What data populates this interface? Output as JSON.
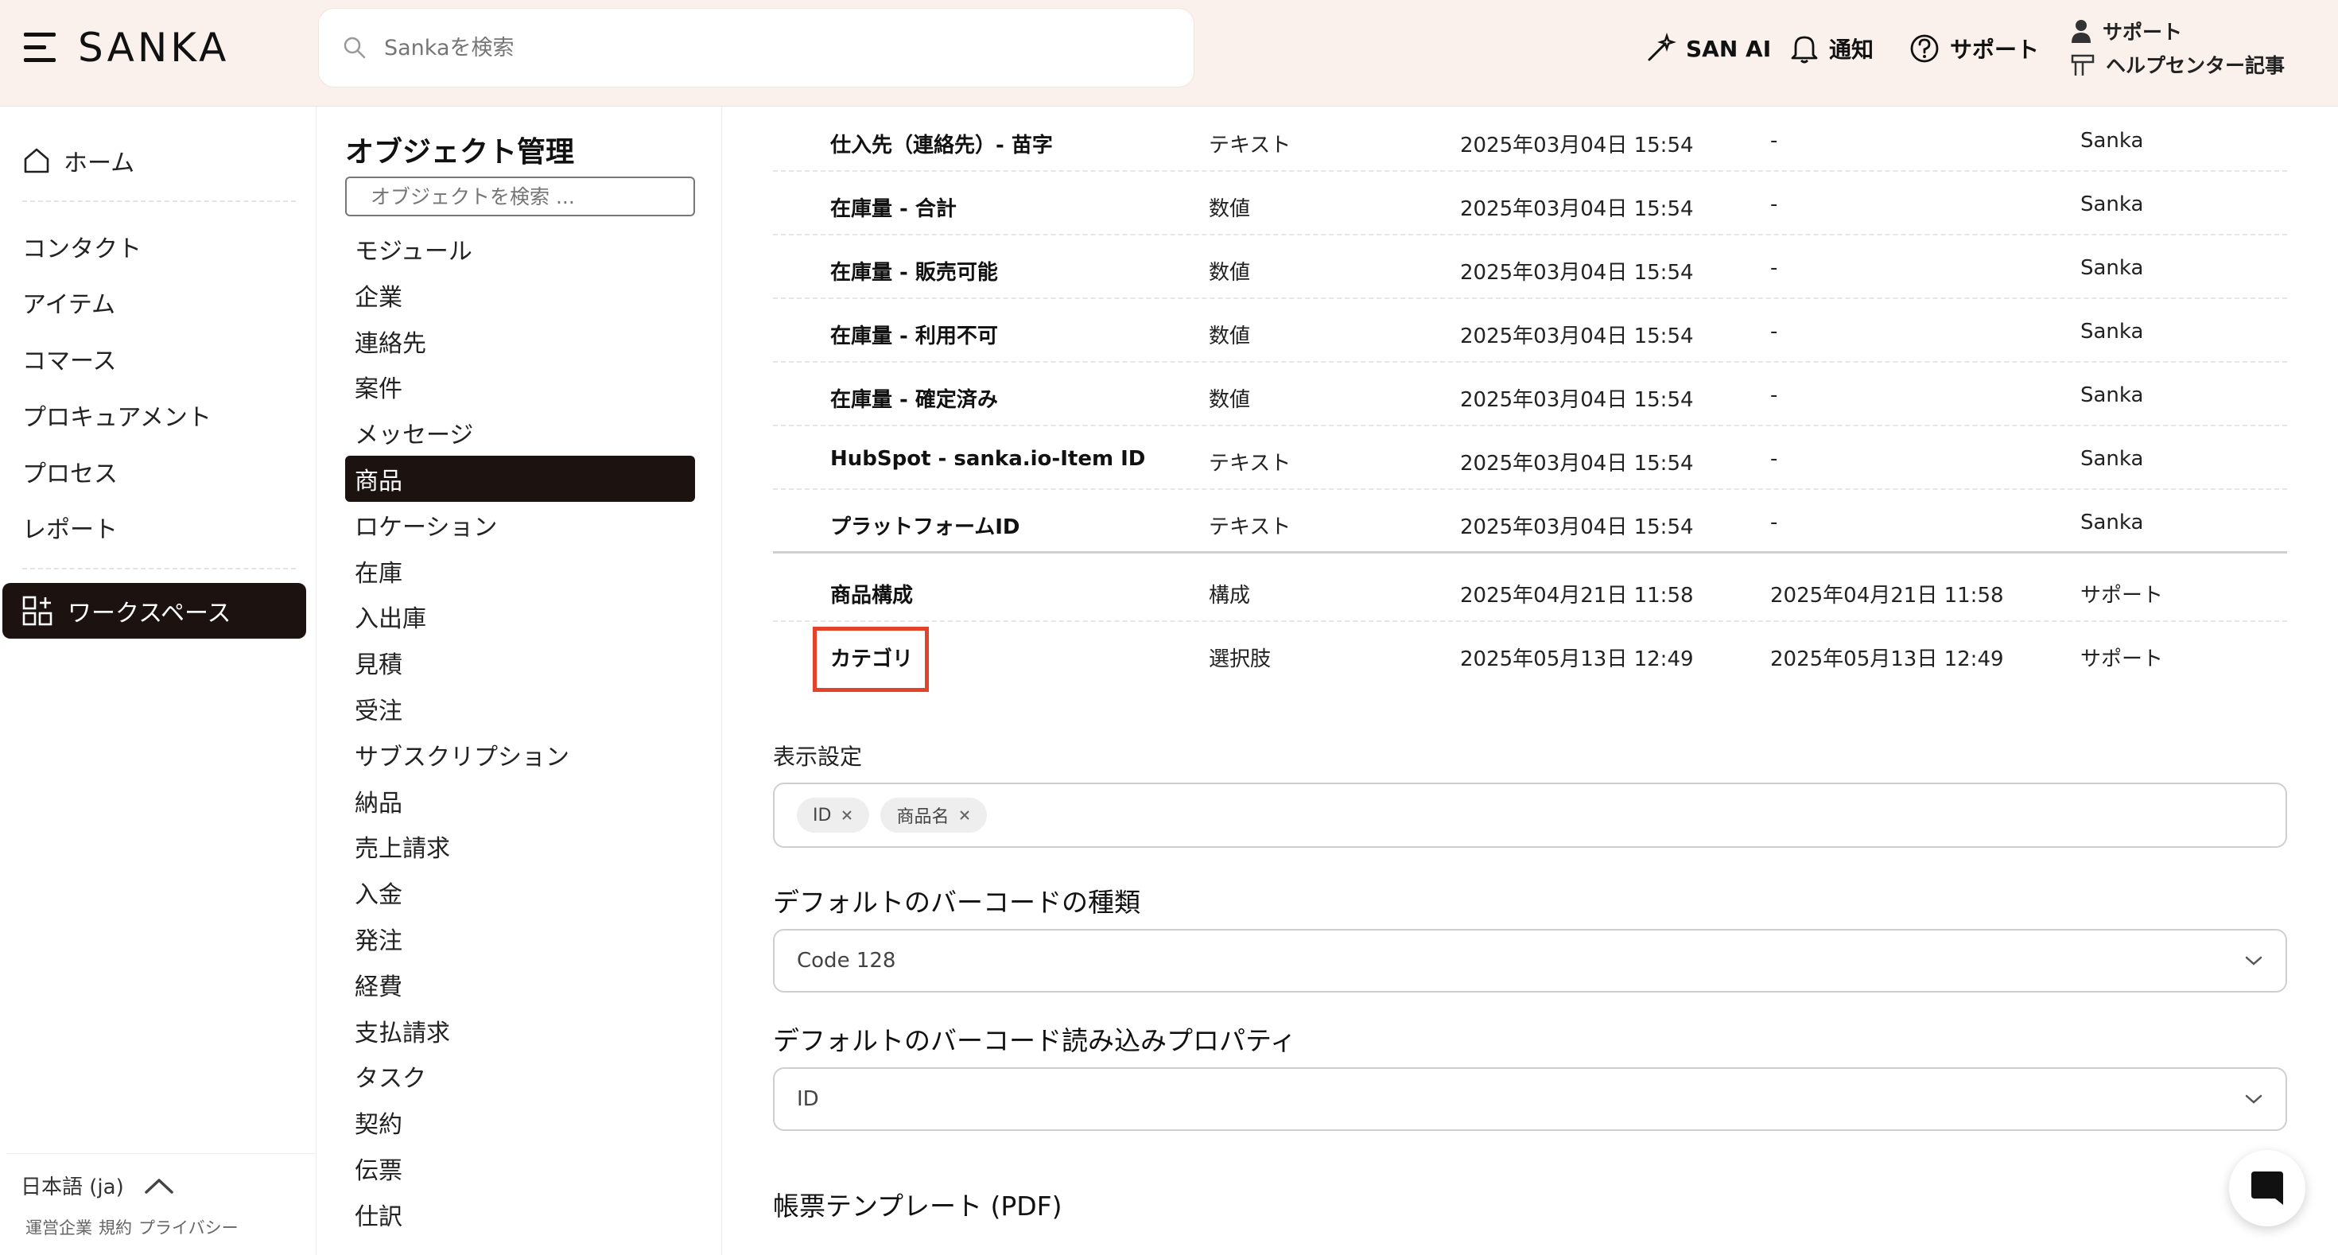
{
  "header": {
    "logo_text": "SANKA",
    "search_placeholder": "Sankaを検索",
    "san_ai": "SAN AI",
    "notifications": "通知",
    "support": "サポート",
    "support_menu": {
      "support": "サポート",
      "help_center": "ヘルプセンター記事"
    }
  },
  "leftnav": {
    "home": "ホーム",
    "items": [
      "コンタクト",
      "アイテム",
      "コマース",
      "プロキュアメント",
      "プロセス",
      "レポート"
    ],
    "workspace": "ワークスペース",
    "language": "日本語 (ja)",
    "legal": [
      "運営企業",
      "規約",
      "プライバシー"
    ]
  },
  "objpanel": {
    "title": "オブジェクト管理",
    "search_placeholder": "オブジェクトを検索 ...",
    "items": [
      "モジュール",
      "企業",
      "連絡先",
      "案件",
      "メッセージ",
      "商品",
      "ロケーション",
      "在庫",
      "入出庫",
      "見積",
      "受注",
      "サブスクリプション",
      "納品",
      "売上請求",
      "入金",
      "発注",
      "経費",
      "支払請求",
      "タスク",
      "契約",
      "伝票",
      "仕訳"
    ],
    "active_index": 5
  },
  "table": {
    "rows": [
      {
        "name": "仕入先（連絡先）- 苗字",
        "type": "テキスト",
        "created": "2025年03月04日 15:54",
        "updated": "-",
        "owner": "Sanka"
      },
      {
        "name": "在庫量 - 合計",
        "type": "数値",
        "created": "2025年03月04日 15:54",
        "updated": "-",
        "owner": "Sanka"
      },
      {
        "name": "在庫量 - 販売可能",
        "type": "数値",
        "created": "2025年03月04日 15:54",
        "updated": "-",
        "owner": "Sanka"
      },
      {
        "name": "在庫量 - 利用不可",
        "type": "数値",
        "created": "2025年03月04日 15:54",
        "updated": "-",
        "owner": "Sanka"
      },
      {
        "name": "在庫量 - 確定済み",
        "type": "数値",
        "created": "2025年03月04日 15:54",
        "updated": "-",
        "owner": "Sanka"
      },
      {
        "name": "HubSpot - sanka.io-Item ID",
        "type": "テキスト",
        "created": "2025年03月04日 15:54",
        "updated": "-",
        "owner": "Sanka"
      },
      {
        "name": "プラットフォームID",
        "type": "テキスト",
        "created": "2025年03月04日 15:54",
        "updated": "-",
        "owner": "Sanka"
      },
      {
        "name": "商品構成",
        "type": "構成",
        "created": "2025年04月21日 11:58",
        "updated": "2025年04月21日 11:58",
        "owner": "サポート"
      },
      {
        "name": "カテゴリ",
        "type": "選択肢",
        "created": "2025年05月13日 12:49",
        "updated": "2025年05月13日 12:49",
        "owner": "サポート"
      }
    ]
  },
  "display_settings": {
    "label": "表示設定",
    "tags": [
      "ID",
      "商品名"
    ]
  },
  "barcode_type": {
    "label": "デフォルトのバーコードの種類",
    "value": "Code 128"
  },
  "barcode_property": {
    "label": "デフォルトのバーコード読み込みプロパティ",
    "value": "ID"
  },
  "pdf_template": {
    "label": "帳票テンプレート (PDF)"
  },
  "colors": {
    "accent_dark": "#1c1311",
    "header_bg": "#faf1ec",
    "highlight": "#e2432a"
  }
}
